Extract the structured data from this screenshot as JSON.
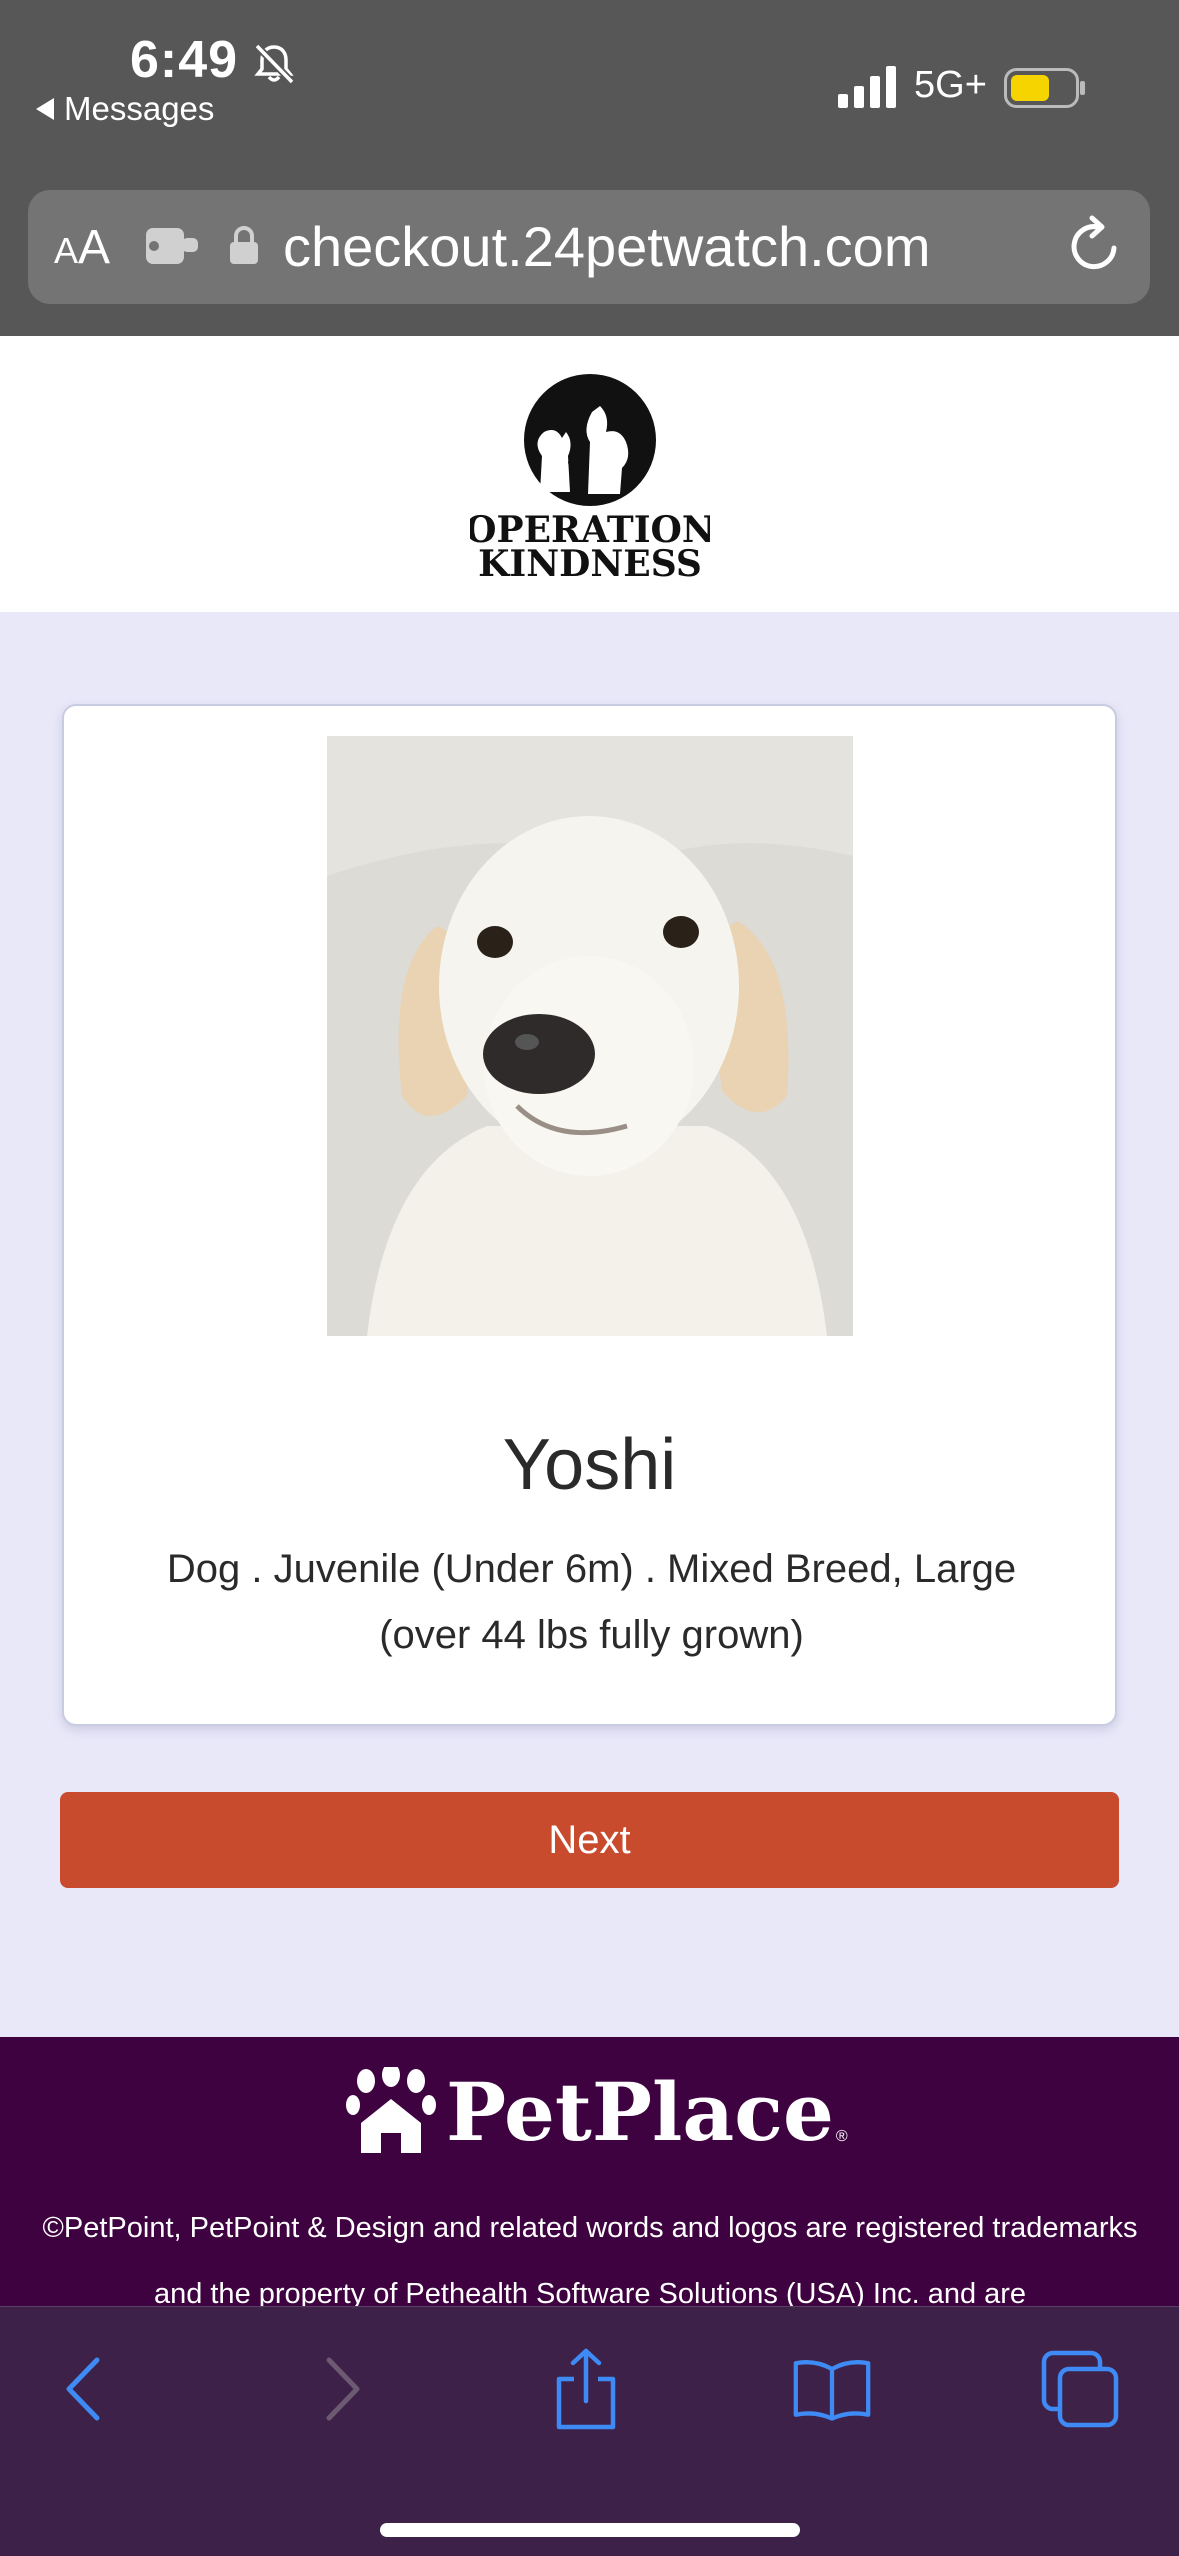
{
  "status_bar": {
    "time": "6:49",
    "back_app": "Messages",
    "network": "5G+",
    "battery_color": "#f5d400"
  },
  "browser": {
    "aa_small": "A",
    "aa_big": "A",
    "url": "checkout.24petwatch.com"
  },
  "header": {
    "logo_line1": "OPERATION",
    "logo_line2": "KINDNESS"
  },
  "pet": {
    "name": "Yoshi",
    "description": "Dog . Juvenile (Under 6m) . Mixed Breed, Large (over 44 lbs fully grown)"
  },
  "actions": {
    "next_label": "Next"
  },
  "footer": {
    "brand": "PetPlace",
    "reg": "®",
    "legal": "©PetPoint, PetPoint & Design and related words and logos are registered trademarks and the property of Pethealth Software Solutions (USA) Inc. and are",
    "bg_color": "#3e0241"
  },
  "colors": {
    "accent": "#c84b2d",
    "page_bg": "#e9e8f9",
    "toolbar_icon": "#3e8bf5"
  },
  "icons": [
    "bell-slash-icon",
    "signal-icon",
    "battery-icon",
    "extension-icon",
    "lock-icon",
    "reload-icon",
    "paw-icon",
    "back-icon",
    "forward-icon",
    "share-icon",
    "bookmarks-icon",
    "tabs-icon"
  ]
}
